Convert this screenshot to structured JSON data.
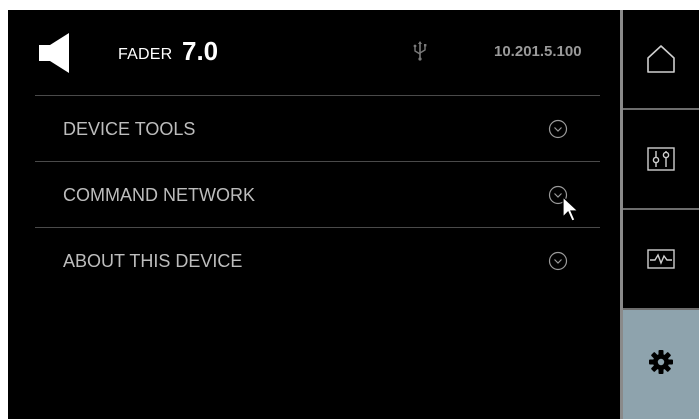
{
  "header": {
    "fader_label": "FADER",
    "fader_value": "7.0",
    "ip_address": "10.201.5.100",
    "speaker_icon": "speaker-icon",
    "usb_icon": "usb-icon"
  },
  "menu": {
    "items": [
      {
        "label": "DEVICE TOOLS",
        "icon": "chevron-down-circle-icon"
      },
      {
        "label": "COMMAND NETWORK",
        "icon": "chevron-down-circle-icon"
      },
      {
        "label": "ABOUT THIS DEVICE",
        "icon": "chevron-down-circle-icon"
      }
    ]
  },
  "sidebar": {
    "items": [
      {
        "name": "home",
        "icon": "home-icon",
        "active": false
      },
      {
        "name": "mixer",
        "icon": "sliders-icon",
        "active": false
      },
      {
        "name": "signal",
        "icon": "waveform-icon",
        "active": false
      },
      {
        "name": "settings",
        "icon": "gear-icon",
        "active": true
      }
    ]
  },
  "colors": {
    "background": "#000000",
    "text": "#bdbdbd",
    "accent_active": "#8ea3ad",
    "divider": "#4a4a4a",
    "ip_text": "#9a9a9a"
  }
}
